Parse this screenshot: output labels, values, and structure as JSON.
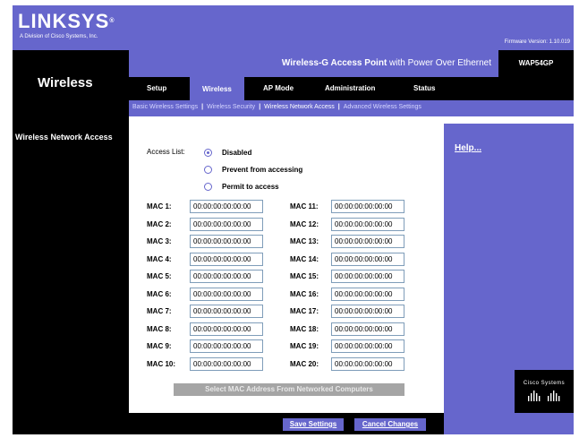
{
  "header": {
    "logo": "LINKSYS",
    "logo_sub": "A Division of Cisco Systems, Inc.",
    "firmware": "Firmware Version: 1.10.019"
  },
  "product": {
    "name_bold": "Wireless-G Access Point",
    "name_rest": " with Power Over Ethernet",
    "model": "WAP54GP"
  },
  "page_title": "Wireless",
  "tabs": [
    {
      "label": "Setup"
    },
    {
      "label": "Wireless"
    },
    {
      "label": "AP Mode"
    },
    {
      "label": "Administration"
    },
    {
      "label": "Status"
    }
  ],
  "subtabs": [
    {
      "label": "Basic Wireless Settings"
    },
    {
      "label": "Wireless Security"
    },
    {
      "label": "Wireless Network Access"
    },
    {
      "label": "Advanced Wireless Settings"
    }
  ],
  "section": "Wireless Network Access",
  "access_list": {
    "label": "Access List:",
    "options": [
      {
        "label": "Disabled",
        "selected": true
      },
      {
        "label": "Prevent from accessing",
        "selected": false
      },
      {
        "label": "Permit to access",
        "selected": false
      }
    ]
  },
  "macs": [
    {
      "label": "MAC 1:",
      "value": "00:00:00:00:00:00"
    },
    {
      "label": "MAC 2:",
      "value": "00:00:00:00:00:00"
    },
    {
      "label": "MAC 3:",
      "value": "00:00:00:00:00:00"
    },
    {
      "label": "MAC 4:",
      "value": "00:00:00:00:00:00"
    },
    {
      "label": "MAC 5:",
      "value": "00:00:00:00:00:00"
    },
    {
      "label": "MAC 6:",
      "value": "00:00:00:00:00:00"
    },
    {
      "label": "MAC 7:",
      "value": "00:00:00:00:00:00"
    },
    {
      "label": "MAC 8:",
      "value": "00:00:00:00:00:00"
    },
    {
      "label": "MAC 9:",
      "value": "00:00:00:00:00:00"
    },
    {
      "label": "MAC 10:",
      "value": "00:00:00:00:00:00"
    },
    {
      "label": "MAC 11:",
      "value": "00:00:00:00:00:00"
    },
    {
      "label": "MAC 12:",
      "value": "00:00:00:00:00:00"
    },
    {
      "label": "MAC 13:",
      "value": "00:00:00:00:00:00"
    },
    {
      "label": "MAC 14:",
      "value": "00:00:00:00:00:00"
    },
    {
      "label": "MAC 15:",
      "value": "00:00:00:00:00:00"
    },
    {
      "label": "MAC 16:",
      "value": "00:00:00:00:00:00"
    },
    {
      "label": "MAC 17:",
      "value": "00:00:00:00:00:00"
    },
    {
      "label": "MAC 18:",
      "value": "00:00:00:00:00:00"
    },
    {
      "label": "MAC 19:",
      "value": "00:00:00:00:00:00"
    },
    {
      "label": "MAC 20:",
      "value": "00:00:00:00:00:00"
    }
  ],
  "select_mac_button": "Select MAC Address From Networked Computers",
  "help": "Help...",
  "cisco": "Cisco Systems",
  "buttons": {
    "save": "Save Settings",
    "cancel": "Cancel Changes"
  },
  "colors": {
    "brand_blue": "#6666cc",
    "dark": "#000000"
  }
}
